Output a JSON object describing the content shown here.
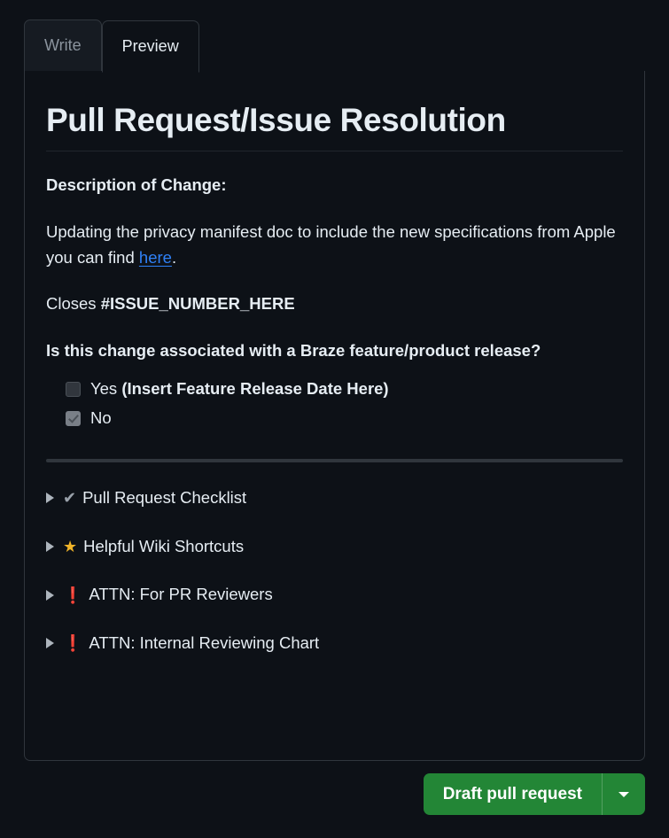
{
  "tabs": [
    {
      "label": "Write",
      "active": false
    },
    {
      "label": "Preview",
      "active": true
    }
  ],
  "document": {
    "title": "Pull Request/Issue Resolution",
    "description_heading": "Description of Change:",
    "description_text_before_link": "Updating the privacy manifest doc to include the new specifications from Apple you can find ",
    "description_link_text": "here",
    "description_text_after_link": ".",
    "closes_prefix": "Closes ",
    "closes_issue": "#ISSUE_NUMBER_HERE",
    "question": "Is this change associated with a Braze feature/product release?",
    "tasklist": [
      {
        "checked": false,
        "label": "Yes ",
        "label_bold": "(Insert Feature Release Date Here)"
      },
      {
        "checked": true,
        "label": "No",
        "label_bold": ""
      }
    ],
    "sections": [
      {
        "icon": "check-mark-emoji",
        "glyph": "✔",
        "label": "Pull Request Checklist"
      },
      {
        "icon": "star-emoji",
        "glyph": "★",
        "label": "Helpful Wiki Shortcuts"
      },
      {
        "icon": "exclamation-emoji",
        "glyph": "❗",
        "label": "ATTN: For PR Reviewers"
      },
      {
        "icon": "exclamation-emoji",
        "glyph": "❗",
        "label": "ATTN: Internal Reviewing Chart"
      }
    ]
  },
  "footer": {
    "submit_label": "Draft pull request",
    "dropdown_icon": "chevron-down-icon"
  },
  "colors": {
    "page_background": "#0d1117",
    "border": "#30363d",
    "text": "#e6edf3",
    "muted_text": "#8b949e",
    "link": "#2f81f7",
    "submit_green": "#238636",
    "star": "#f0b429",
    "alert_red": "#e52424"
  }
}
